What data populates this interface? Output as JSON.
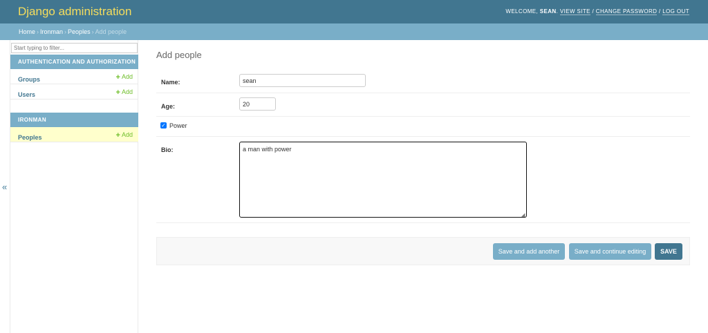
{
  "header": {
    "branding": "Django administration",
    "welcome_prefix": "WELCOME, ",
    "username": "SEAN",
    "welcome_suffix": ".",
    "view_site": "VIEW SITE",
    "change_password": "CHANGE PASSWORD",
    "log_out": "LOG OUT",
    "separator": " / "
  },
  "breadcrumbs": [
    "Home",
    "Ironman",
    "Peoples",
    "Add people"
  ],
  "breadcrumb_separator": "›",
  "sidebar": {
    "filter_placeholder": "Start typing to filter...",
    "collapse_icon": "«",
    "modules": [
      {
        "caption": "AUTHENTICATION AND AUTHORIZATION",
        "models": [
          {
            "name": "Groups",
            "add_label": "Add"
          },
          {
            "name": "Users",
            "add_label": "Add"
          }
        ]
      },
      {
        "caption": "IRONMAN",
        "models": [
          {
            "name": "Peoples",
            "add_label": "Add",
            "current": true
          }
        ]
      }
    ]
  },
  "main": {
    "title": "Add people",
    "fields": {
      "name": {
        "label": "Name:",
        "value": "sean"
      },
      "age": {
        "label": "Age:",
        "value": "20"
      },
      "power": {
        "label": "Power",
        "checked": true
      },
      "bio": {
        "label": "Bio:",
        "value": "a man with power"
      }
    },
    "buttons": {
      "save_add_another": "Save and add another",
      "save_continue": "Save and continue editing",
      "save": "SAVE"
    }
  },
  "colors": {
    "header_bg": "#417690",
    "branding": "#f5dd5d",
    "breadcrumbs_bg": "#79aec8",
    "link": "#417690",
    "add_link": "#70bf2b",
    "current_row": "#ffffcc",
    "default_button": "#417690",
    "secondary_button": "#79aec8"
  }
}
